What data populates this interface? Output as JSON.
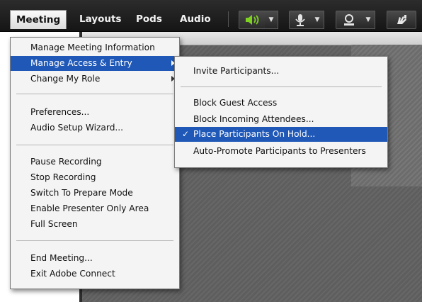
{
  "menubar": {
    "items": [
      {
        "label": "Meeting",
        "active": true
      },
      {
        "label": "Layouts"
      },
      {
        "label": "Pods"
      },
      {
        "label": "Audio"
      }
    ],
    "icons": [
      "speaker-icon",
      "microphone-icon",
      "webcam-icon",
      "raise-hand-icon"
    ],
    "accent_green": "#7ed321"
  },
  "meeting_menu": {
    "groups": [
      [
        {
          "label": "Manage Meeting Information"
        },
        {
          "label": "Manage Access & Entry",
          "submenu": true,
          "highlighted": true
        },
        {
          "label": "Change My Role",
          "submenu": true
        }
      ],
      [
        {
          "label": "Preferences..."
        },
        {
          "label": "Audio Setup Wizard..."
        }
      ],
      [
        {
          "label": "Pause Recording"
        },
        {
          "label": "Stop Recording"
        },
        {
          "label": "Switch To Prepare Mode"
        },
        {
          "label": "Enable Presenter Only Area"
        },
        {
          "label": "Full Screen"
        }
      ],
      [
        {
          "label": "End Meeting..."
        },
        {
          "label": "Exit Adobe Connect"
        }
      ]
    ]
  },
  "access_submenu": {
    "groups": [
      [
        {
          "label": "Invite Participants..."
        }
      ],
      [
        {
          "label": "Block Guest Access"
        },
        {
          "label": "Block Incoming Attendees..."
        },
        {
          "label": "Place Participants On Hold...",
          "checked": true,
          "highlighted": true
        },
        {
          "label": "Auto-Promote Participants to Presenters"
        }
      ]
    ],
    "check_glyph": "✓"
  },
  "colors": {
    "highlight": "#1f58b7",
    "menu_bg": "#f4f4f4",
    "bar_bg": "#1b1b1b"
  }
}
